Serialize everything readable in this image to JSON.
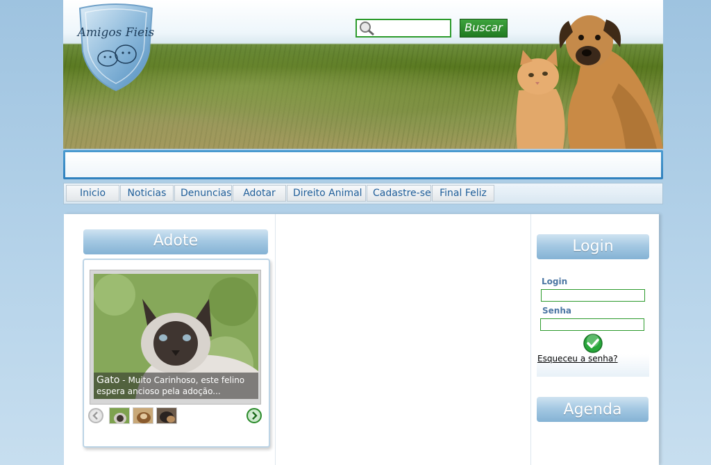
{
  "header": {
    "logo_text": "Amigos Fieis",
    "search": {
      "placeholder": "",
      "value": "",
      "button_label": "Buscar"
    }
  },
  "nav": {
    "items": [
      {
        "label": "Inicio"
      },
      {
        "label": "Noticias"
      },
      {
        "label": "Denuncias"
      },
      {
        "label": "Adotar"
      },
      {
        "label": "Direito Animal"
      },
      {
        "label": "Cadastre-se"
      },
      {
        "label": "Final Feliz"
      }
    ]
  },
  "adote": {
    "title": "Adote",
    "slide": {
      "title": "Gato",
      "separator": " - ",
      "description": "Muito Carinhoso, este felino espera ancioso pela adoção..."
    }
  },
  "login": {
    "title": "Login",
    "login_label": "Login",
    "password_label": "Senha",
    "forgot_label": "Esqueceu a senha?"
  },
  "agenda": {
    "title": "Agenda"
  },
  "colors": {
    "accent_green": "#2b9a2b",
    "nav_text": "#1f5e99",
    "section_header": "#84b2d4"
  }
}
